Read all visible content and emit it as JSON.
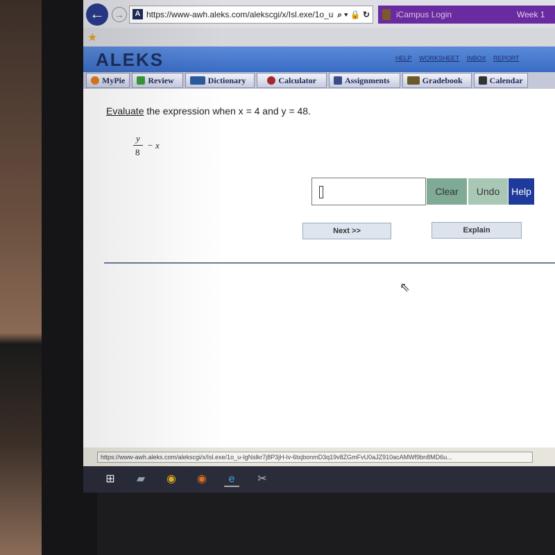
{
  "browser": {
    "url": "https://www-awh.aleks.com/alekscgi/x/Isl.exe/1o_u",
    "tab_title": "iCampus Login",
    "tab2_title": "Week 1",
    "status_url": "https://www-awh.aleks.com/alekscgi/x/Isl.exe/1o_u-IgNslkr7j8P3jH-lv-6txjbonmD3q19v8ZGmFvU0aJZ910acAMWf9bn8MD6u..."
  },
  "header": {
    "logo": "ALEKS",
    "links": [
      "HELP",
      "WORKSHEET",
      "INBOX",
      "REPORT"
    ]
  },
  "nav": {
    "items": [
      {
        "label": "MyPie",
        "icon": "pie-chart-icon",
        "color": "#e07a20"
      },
      {
        "label": "Review",
        "icon": "checkmark-icon",
        "color": "#3a9a3a"
      },
      {
        "label": "Dictionary",
        "icon": "book-icon",
        "color": "#2a5aa0"
      },
      {
        "label": "Calculator",
        "icon": "calculator-icon",
        "color": "#a02a2a"
      },
      {
        "label": "Assignments",
        "icon": "assignment-icon",
        "color": "#3a4a8a"
      },
      {
        "label": "Gradebook",
        "icon": "gradebook-icon",
        "color": "#6a5a2a"
      },
      {
        "label": "Calendar",
        "icon": "calendar-icon",
        "color": "#333333"
      }
    ]
  },
  "question": {
    "verb": "Evaluate",
    "text": " the expression when x = 4 and y = 48.",
    "numerator": "y",
    "denominator": "8",
    "rest": "− x"
  },
  "answer": {
    "value": ""
  },
  "buttons": {
    "clear": "Clear",
    "undo": "Undo",
    "help": "Help",
    "next": "Next >>",
    "explain": "Explain"
  },
  "colors": {
    "header_blue": "#3a6cc4",
    "help_blue": "#1e3a9a",
    "clear_green": "#7faa95"
  }
}
